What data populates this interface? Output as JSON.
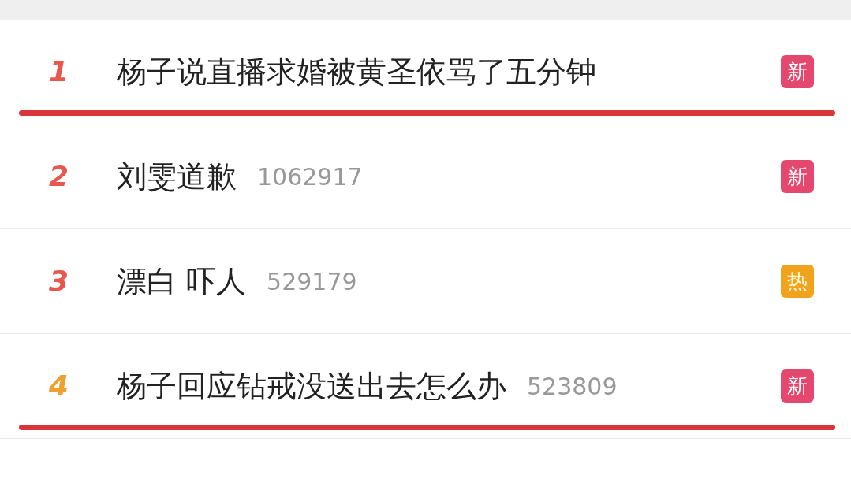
{
  "hot_search": [
    {
      "rank": "1",
      "color": "#e8574e",
      "title": "杨子说直播求婚被黄圣依骂了五分钟",
      "badge": {
        "text": "新",
        "kind": "new"
      },
      "underlined": true
    },
    {
      "rank": "2",
      "color": "#e8574e",
      "title": "刘雯道歉",
      "count": "1062917",
      "badge": {
        "text": "新",
        "kind": "new"
      },
      "underlined": false
    },
    {
      "rank": "3",
      "color": "#e8574e",
      "title": "漂白 吓人",
      "count": "529179",
      "badge": {
        "text": "热",
        "kind": "hot"
      },
      "underlined": false
    },
    {
      "rank": "4",
      "color": "#f0a030",
      "title": "杨子回应钻戒没送出去怎么办",
      "count": "523809",
      "badge": {
        "text": "新",
        "kind": "new"
      },
      "underlined": true
    }
  ]
}
